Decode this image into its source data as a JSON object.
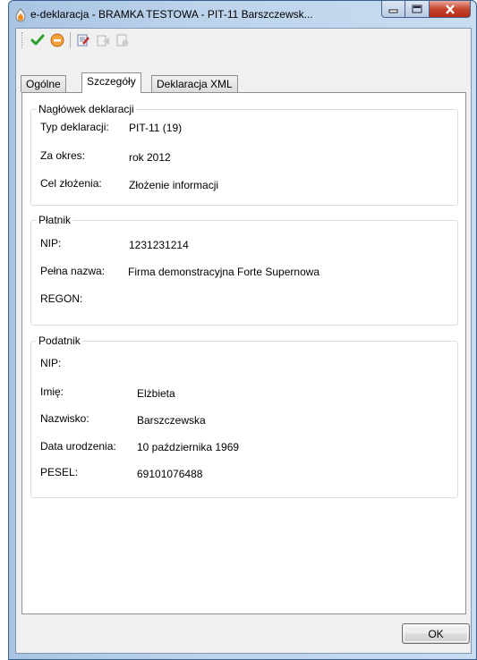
{
  "window": {
    "title": "e-deklaracja - BRAMKA TESTOWA - PIT-11 Barszczewsk..."
  },
  "toolbar": {
    "buttons": [
      "check-icon",
      "stop-icon",
      "edit-document-icon",
      "send-document-icon",
      "signed-document-icon"
    ]
  },
  "tabs": [
    {
      "label": "Ogólne"
    },
    {
      "label": "Szczegóły"
    },
    {
      "label": "Deklaracja XML"
    }
  ],
  "naglowek": {
    "legend": "Nagłówek deklaracji",
    "typ_label": "Typ deklaracji:",
    "typ_value": "PIT-11 (19)",
    "okres_label": "Za okres:",
    "okres_value": "rok 2012",
    "cel_label": "Cel złożenia:",
    "cel_value": "Złożenie informacji"
  },
  "platnik": {
    "legend": "Płatnik",
    "nip_label": "NIP:",
    "nip_value": "1231231214",
    "nazwa_label": "Pełna nazwa:",
    "nazwa_value": "Firma demonstracyjna Forte Supernowa",
    "regon_label": "REGON:"
  },
  "podatnik": {
    "legend": "Podatnik",
    "nip_label": "NIP:",
    "imie_label": "Imię:",
    "imie_value": "Elżbieta",
    "nazwisko_label": "Nazwisko:",
    "nazwisko_value": "Barszczewska",
    "data_label": "Data urodzenia:",
    "data_value": "10 października 1969",
    "pesel_label": "PESEL:",
    "pesel_value": "69101076488"
  },
  "footer": {
    "ok_label": "OK"
  },
  "colors": {
    "titlebar": "#bcd3ec",
    "close": "#c7452d",
    "group_border": "#d5dfe5"
  }
}
